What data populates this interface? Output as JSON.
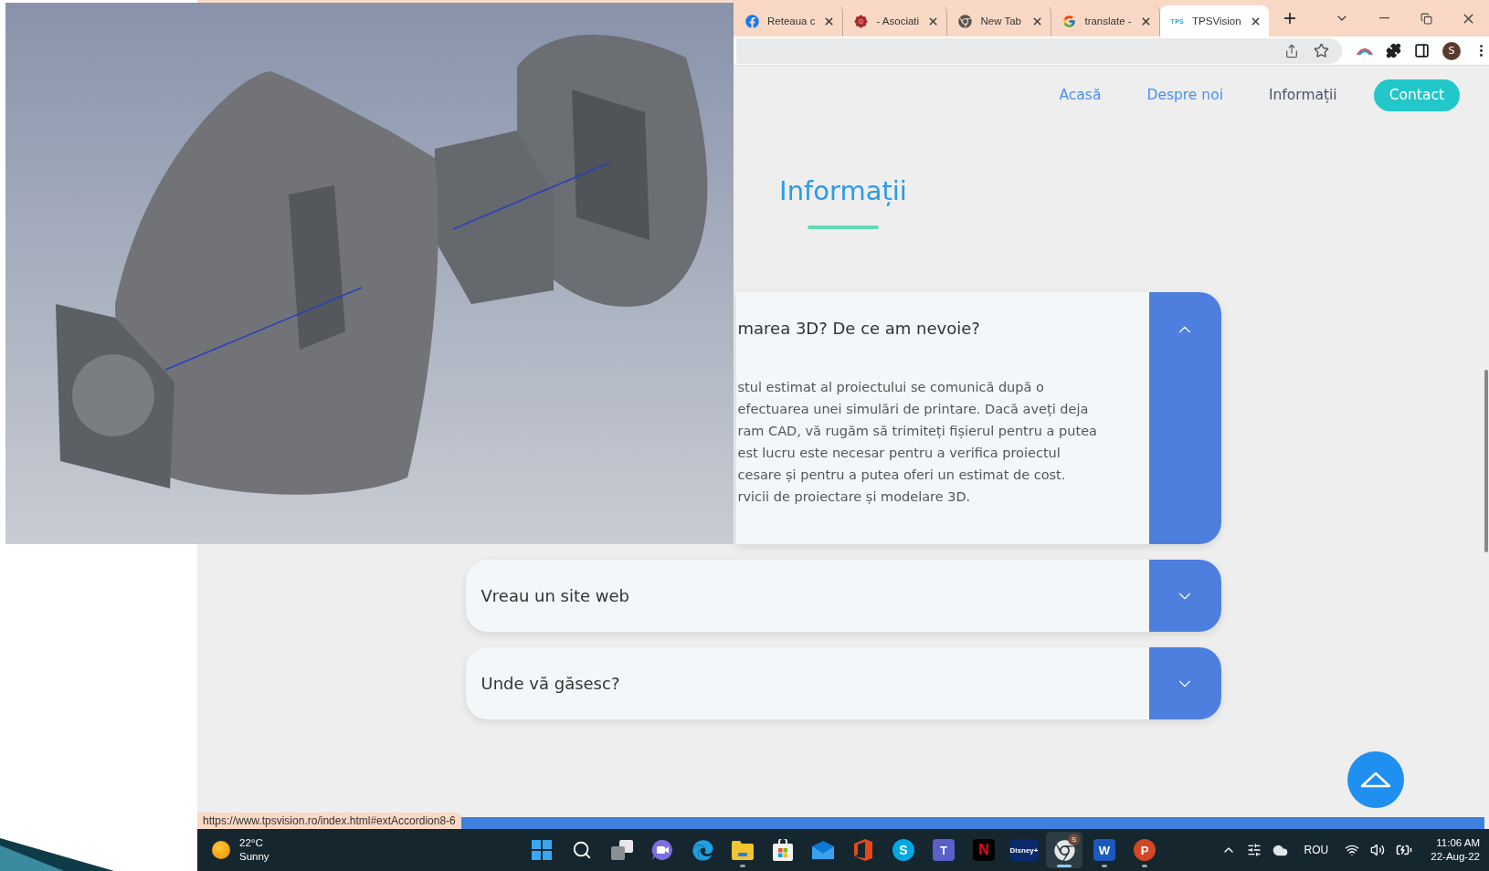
{
  "browser": {
    "tabs": [
      {
        "kind": "facebook",
        "title": "Reteaua c",
        "selected": false
      },
      {
        "kind": "flower",
        "title": "- Asociati",
        "selected": false
      },
      {
        "kind": "chrome",
        "title": "New Tab",
        "selected": false
      },
      {
        "kind": "google",
        "title": "translate -",
        "selected": false
      },
      {
        "kind": "text",
        "icon_text": "TPS",
        "title": "TPSVision",
        "selected": true
      }
    ],
    "profile_initial": "S"
  },
  "site": {
    "nav": [
      {
        "label": "Acasă",
        "kind": "link",
        "selected": false
      },
      {
        "label": "Despre noi",
        "kind": "link",
        "selected": false
      },
      {
        "label": "Informații",
        "kind": "link",
        "selected": true
      },
      {
        "label": "Contact",
        "kind": "button",
        "selected": false
      }
    ],
    "title": "Informații",
    "accordion": [
      {
        "title": "marea 3D? De ce am nevoie?",
        "expanded": true,
        "body_lines": [
          "stul estimat al proiectului se comunică după o",
          "efectuarea unei simulări de printare. Dacă aveți deja",
          "ram CAD, vă rugăm să trimiteți fișierul pentru a putea",
          "est lucru este necesar pentru a verifica proiectul",
          "cesare și pentru a putea oferi un estimat de cost.",
          "rvicii de proiectare și modelare 3D."
        ]
      },
      {
        "title": "Vreau un site web",
        "expanded": false
      },
      {
        "title": "Unde vă găsesc?",
        "expanded": false
      }
    ]
  },
  "status_url": "https://www.tpsvision.ro/index.html#extAccordion8-6",
  "taskbar": {
    "weather": {
      "temperature": "22°C",
      "condition": "Sunny"
    },
    "apps": [
      {
        "kind": "start",
        "running": false,
        "selected": false
      },
      {
        "kind": "search",
        "running": false,
        "selected": false
      },
      {
        "kind": "taskview",
        "running": false,
        "selected": false
      },
      {
        "kind": "chat",
        "running": false,
        "selected": false
      },
      {
        "kind": "edge",
        "running": false,
        "selected": false
      },
      {
        "kind": "files",
        "running": true,
        "selected": false
      },
      {
        "kind": "store",
        "running": false,
        "selected": false
      },
      {
        "kind": "mail",
        "running": false,
        "selected": false
      },
      {
        "kind": "office",
        "running": false,
        "selected": false
      },
      {
        "kind": "skype",
        "glyph": "S",
        "running": false,
        "selected": false
      },
      {
        "kind": "teams",
        "glyph": "T",
        "running": false,
        "selected": false
      },
      {
        "kind": "netflix",
        "glyph": "N",
        "running": false,
        "selected": false
      },
      {
        "kind": "disney",
        "glyph": "Disney+",
        "running": false,
        "selected": false
      },
      {
        "kind": "chrome",
        "badge": "S",
        "running": true,
        "selected": true
      },
      {
        "kind": "word",
        "glyph": "W",
        "running": true,
        "selected": false
      },
      {
        "kind": "powerpoint",
        "glyph": "P",
        "running": true,
        "selected": false
      }
    ],
    "tray": {
      "language": "ROU",
      "time": "11:06 AM",
      "date": "22-Aug-22"
    }
  }
}
